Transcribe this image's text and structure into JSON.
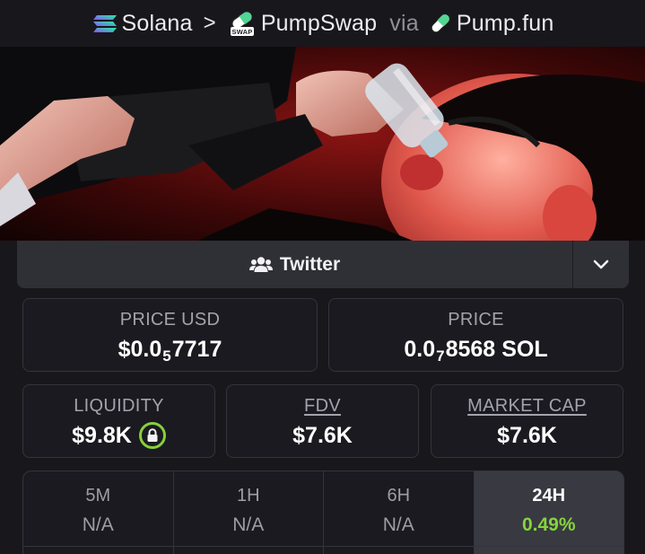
{
  "breadcrumb": {
    "chain": "Solana",
    "separator": ">",
    "dex": "PumpSwap",
    "via": "via",
    "launchpad": "Pump.fun"
  },
  "banner": {
    "icon": "token-header-image"
  },
  "links": {
    "twitter_label": "Twitter",
    "twitter_icon": "users-icon",
    "more_icon": "chevron-down-icon"
  },
  "stats": {
    "price_usd": {
      "label": "PRICE USD",
      "prefix": "$0.0",
      "zeros": "5",
      "digits": "7717"
    },
    "price_native": {
      "label": "PRICE",
      "prefix": "0.0",
      "zeros": "7",
      "digits": "8568",
      "unit": "SOL"
    },
    "liquidity": {
      "label": "LIQUIDITY",
      "value": "$9.8K",
      "locked_icon": "lock-icon"
    },
    "fdv": {
      "label": "FDV",
      "value": "$7.6K"
    },
    "market_cap": {
      "label": "MARKET CAP",
      "value": "$7.6K"
    }
  },
  "timeframes": [
    {
      "label": "5M",
      "change": "N/A",
      "active": false
    },
    {
      "label": "1H",
      "change": "N/A",
      "active": false
    },
    {
      "label": "6H",
      "change": "N/A",
      "active": false
    },
    {
      "label": "24H",
      "change": "0.49%",
      "active": true
    }
  ],
  "colors": {
    "background": "#18171c",
    "panel": "#2f2f36",
    "positive": "#85d43c",
    "muted": "#a3a3ad"
  }
}
